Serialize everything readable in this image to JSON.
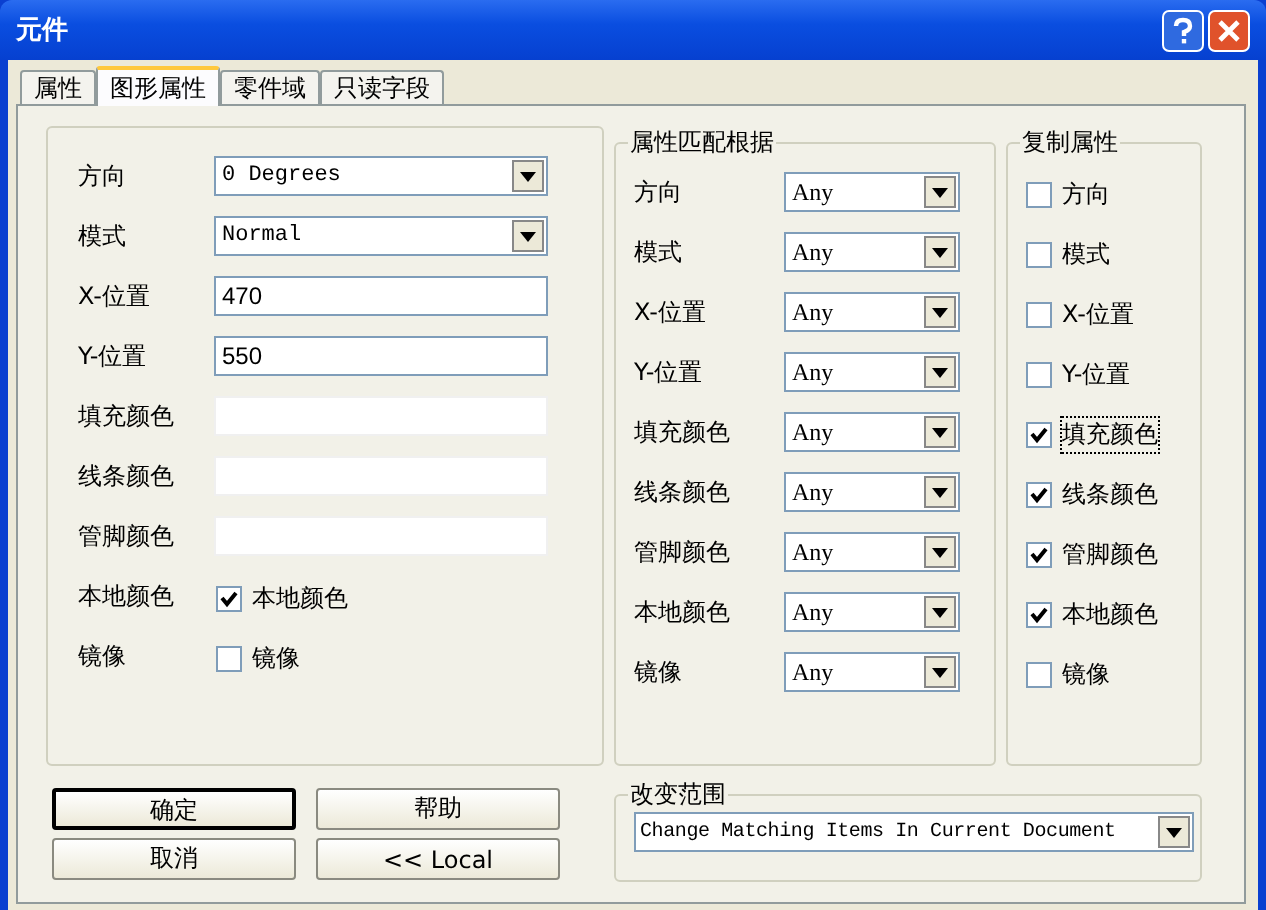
{
  "window": {
    "title": "元件"
  },
  "tabs": [
    {
      "label": "属性",
      "selected": false
    },
    {
      "label": "图形属性",
      "selected": true
    },
    {
      "label": "零件域",
      "selected": false
    },
    {
      "label": "只读字段",
      "selected": false
    }
  ],
  "graphics": {
    "rows": [
      {
        "label": "方向",
        "kind": "dropdown",
        "value": "0 Degrees"
      },
      {
        "label": "模式",
        "kind": "dropdown",
        "value": "Normal"
      },
      {
        "label": "X-位置",
        "kind": "text",
        "value": "470"
      },
      {
        "label": "Y-位置",
        "kind": "text",
        "value": "550"
      },
      {
        "label": "填充颜色",
        "kind": "color"
      },
      {
        "label": "线条颜色",
        "kind": "color"
      },
      {
        "label": "管脚颜色",
        "kind": "color"
      },
      {
        "label": "本地颜色",
        "kind": "checkbox",
        "checkbox_label": "本地颜色",
        "checked": true
      },
      {
        "label": "镜像",
        "kind": "checkbox",
        "checkbox_label": "镜像",
        "checked": false
      }
    ]
  },
  "match_by": {
    "title": "属性匹配根据",
    "rows": [
      {
        "label": "方向",
        "value": "Any"
      },
      {
        "label": "模式",
        "value": "Any"
      },
      {
        "label": "X-位置",
        "value": "Any"
      },
      {
        "label": "Y-位置",
        "value": "Any"
      },
      {
        "label": "填充颜色",
        "value": "Any"
      },
      {
        "label": "线条颜色",
        "value": "Any"
      },
      {
        "label": "管脚颜色",
        "value": "Any"
      },
      {
        "label": "本地颜色",
        "value": "Any"
      },
      {
        "label": "镜像",
        "value": "Any"
      }
    ]
  },
  "copy_attributes": {
    "title": "复制属性",
    "items": [
      {
        "label": "方向",
        "checked": false,
        "focused": false
      },
      {
        "label": "模式",
        "checked": false,
        "focused": false
      },
      {
        "label": "X-位置",
        "checked": false,
        "focused": false
      },
      {
        "label": "Y-位置",
        "checked": false,
        "focused": false
      },
      {
        "label": "填充颜色",
        "checked": true,
        "focused": true
      },
      {
        "label": "线条颜色",
        "checked": true,
        "focused": false
      },
      {
        "label": "管脚颜色",
        "checked": true,
        "focused": false
      },
      {
        "label": "本地颜色",
        "checked": true,
        "focused": false
      },
      {
        "label": "镜像",
        "checked": false,
        "focused": false
      }
    ]
  },
  "buttons": [
    {
      "label": "确定",
      "default": true
    },
    {
      "label": "帮助",
      "default": false
    },
    {
      "label": "取消",
      "default": false
    },
    {
      "label": "<< Local",
      "default": false
    }
  ],
  "change_scope": {
    "title": "改变范围",
    "value": "Change Matching Items In Current Document"
  }
}
